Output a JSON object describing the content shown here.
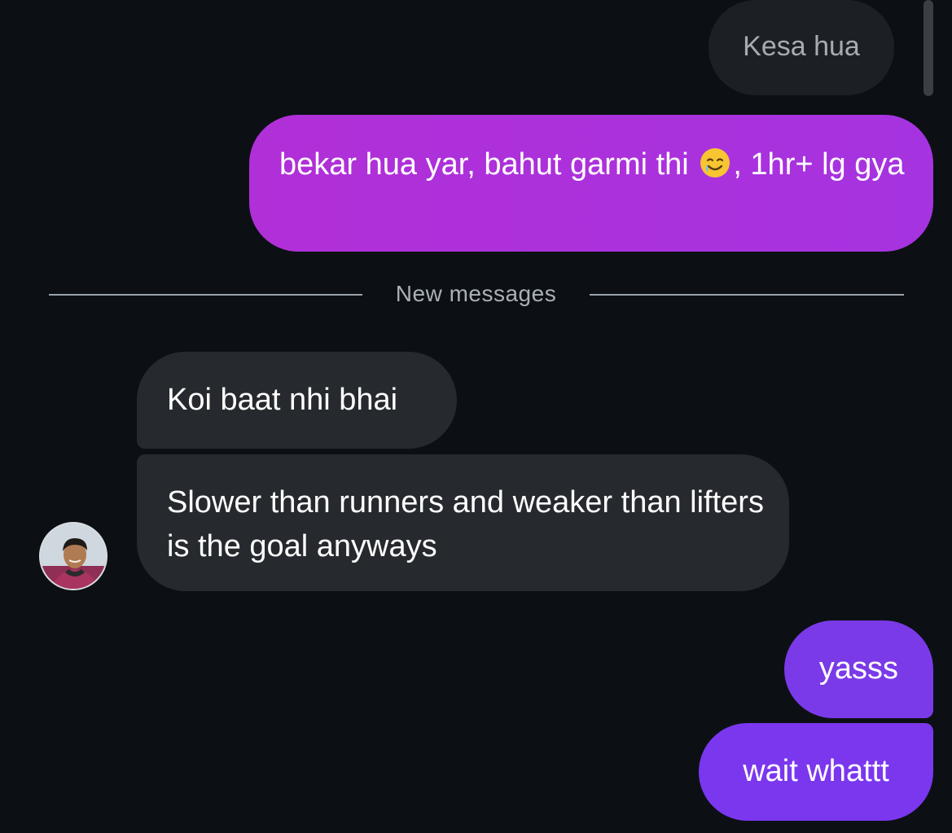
{
  "thread": {
    "previous_message": "Kesa hua",
    "sent_long_before_emoji": "bekar hua yar, bahut garmi thi",
    "sent_long_after_emoji": ", 1hr+ lg gya",
    "sent_long_emoji_name": "smiling-face-with-tear-icon",
    "divider_label": "New messages",
    "received": [
      {
        "text": "Koi baat nhi bhai"
      },
      {
        "text": "Slower than runners and weaker than lifters is the goal anyways"
      }
    ],
    "sent": [
      {
        "text": "yasss"
      },
      {
        "text": "wait whattt"
      }
    ]
  },
  "colors": {
    "background": "#0c1014",
    "sent_gradient_start": "#b12fd7",
    "sent_purple": "#7a3ae8",
    "received_bubble": "#262a2e",
    "divider": "#9aa2ab"
  }
}
